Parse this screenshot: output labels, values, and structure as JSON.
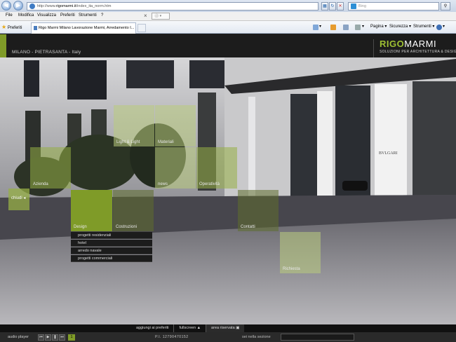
{
  "browser": {
    "url_prefix": "http://www.",
    "url_domain": "rigomarmi.it",
    "url_path": "/index_ita_norm.htm",
    "search_placeholder": "Bing",
    "menu": [
      "File",
      "Modifica",
      "Visualizza",
      "Preferiti",
      "Strumenti",
      "?"
    ],
    "favorites_label": "Preferiti",
    "tab_title": "Rigo Marmi Milano Lavorazione Marmi, Arredamento I...",
    "commands": {
      "page": "Pagina",
      "security": "Sicurezza",
      "tools": "Strumenti"
    }
  },
  "site": {
    "location": "MILANO - PIETRASANTA - Italy",
    "logo_part1": "RIGO",
    "logo_part2": "MARMI",
    "tagline": "SOLUZIONI PER ARCHITETTURA & DESIGN",
    "tiles": {
      "light_light": "Light & Light",
      "materiali": "Materiali",
      "azienda": "Azienda",
      "news": "news",
      "operativita": "Operatività",
      "design": "Design",
      "costruzioni": "Costruzioni",
      "contatti": "Contatti",
      "richiesta": "Richiesta"
    },
    "chiudi": "chiudi",
    "submenu": [
      "progetti residenziali",
      "hotel",
      "arredo navale",
      "progetti commerciali"
    ],
    "building_sign": "BVLGARI"
  },
  "footer": {
    "links": [
      "aggiungi ai preferiti",
      "fullscreen",
      "area riservata"
    ],
    "audio_label": "audio player",
    "track_number": "1",
    "piva": "P.I. 12790470152",
    "session_label": "sei nella sezione"
  }
}
